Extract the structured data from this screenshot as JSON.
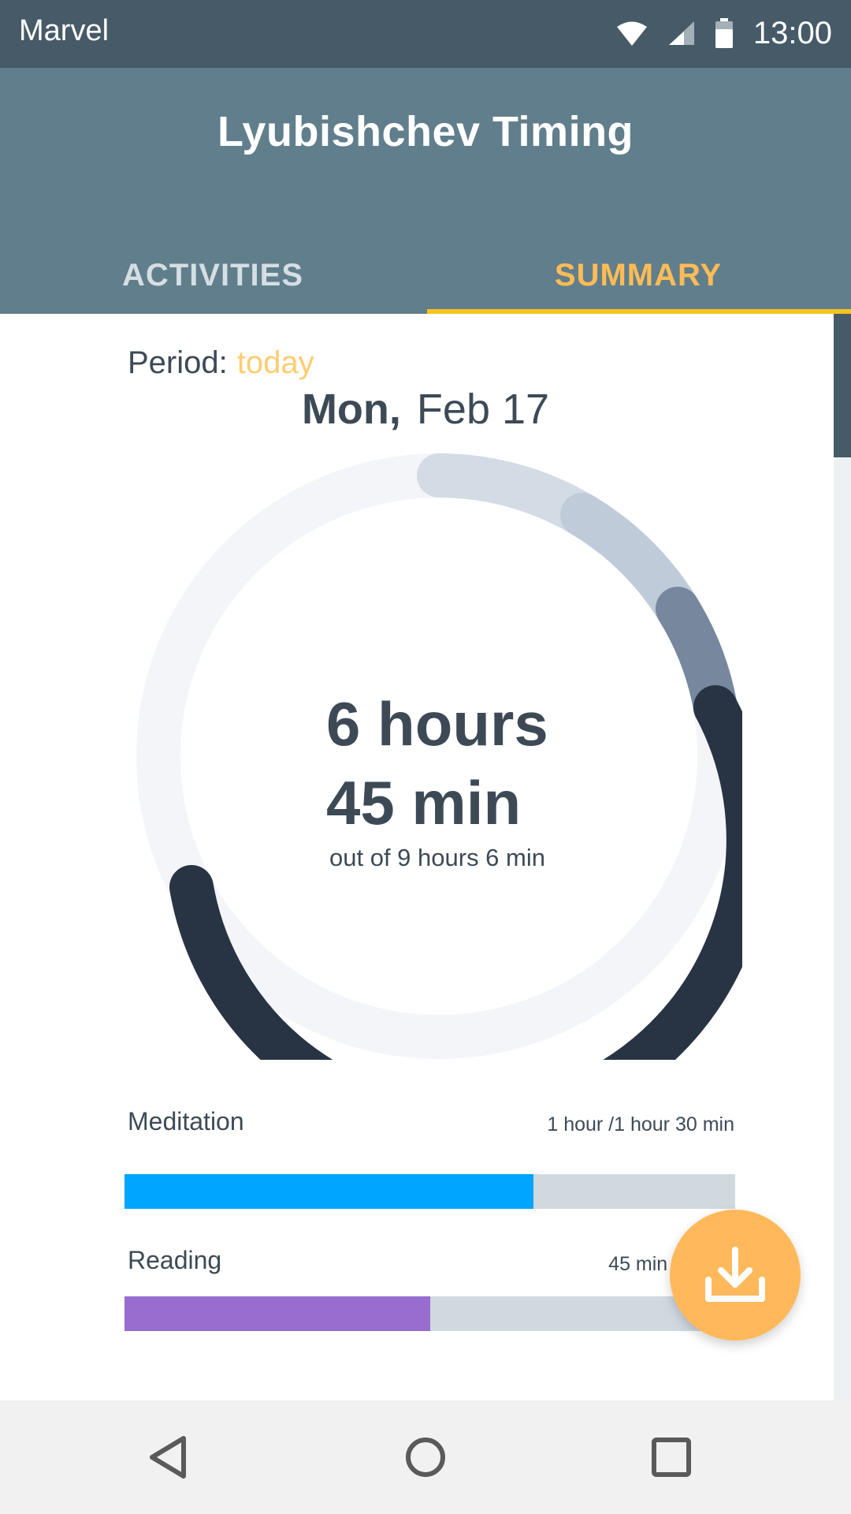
{
  "status_bar": {
    "carrier": "Marvel",
    "time": "13:00",
    "icons": [
      "wifi-icon",
      "signal-icon",
      "battery-icon"
    ]
  },
  "app_bar": {
    "title": "Lyubishchev Timing",
    "tabs": [
      {
        "label": "ACTIVITIES",
        "active": false
      },
      {
        "label": "SUMMARY",
        "active": true
      }
    ]
  },
  "summary": {
    "period_label": "Period:",
    "period_value": "today",
    "date_day": "Mon,",
    "date_rest": "Feb 17",
    "total_hours": "6 hours",
    "total_minutes": "45 min",
    "total_caption": "out of 9 hours 6 min",
    "progress_fraction": 0.74
  },
  "activities": [
    {
      "name": "Meditation",
      "ratio": "1 hour /1 hour 30 min",
      "fraction": 0.67,
      "color": "#00a5ff"
    },
    {
      "name": "Reading",
      "ratio": "45 min /1 hour",
      "fraction": 0.5,
      "color": "#976dd0"
    }
  ],
  "colors": {
    "status_bar": "#465a67",
    "app_bar": "#617e8c",
    "accent": "#ffbc56",
    "tab_indicator": "#f7c31e",
    "ring_dark": "#283444",
    "ring_track": "#f3f5f8",
    "fab": "#ffb95b"
  },
  "fab": {
    "icon": "download-icon"
  },
  "nav": {
    "icons": [
      "back-icon",
      "home-icon",
      "recents-icon"
    ]
  }
}
